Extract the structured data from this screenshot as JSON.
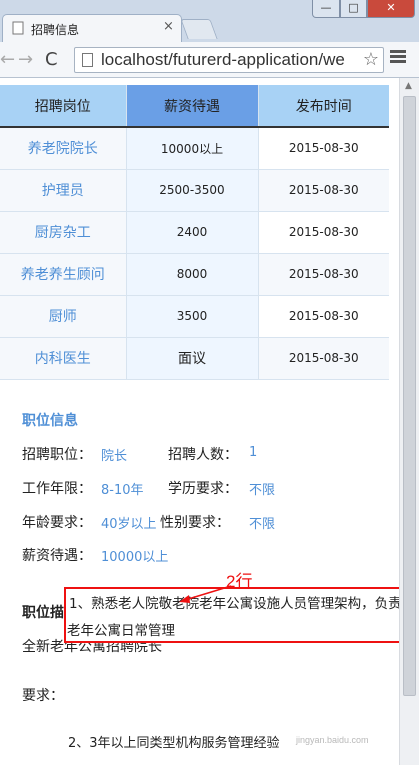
{
  "browser": {
    "tab_title": "招聘信息",
    "tab_close": "×",
    "url": "localhost/futurerd-application/we",
    "window_controls": {
      "minimize": "—",
      "maximize": "□",
      "close": "✕"
    },
    "nav": {
      "back": "←",
      "forward": "→",
      "reload": "C"
    },
    "star": "☆"
  },
  "table": {
    "headers": [
      "招聘岗位",
      "薪资待遇",
      "发布时间"
    ],
    "active_header_index": 1,
    "rows": [
      {
        "position": "养老院院长",
        "salary": "10000以上",
        "date": "2015-08-30"
      },
      {
        "position": "护理员",
        "salary": "2500-3500",
        "date": "2015-08-30"
      },
      {
        "position": "厨房杂工",
        "salary": "2400",
        "date": "2015-08-30"
      },
      {
        "position": "养老养生顾问",
        "salary": "8000",
        "date": "2015-08-30"
      },
      {
        "position": "厨师",
        "salary": "3500",
        "date": "2015-08-30"
      },
      {
        "position": "内科医生",
        "salary": "面议",
        "date": "2015-08-30"
      }
    ]
  },
  "job_info": {
    "title": "职位信息",
    "position_label": "招聘职位：",
    "position_value": "院长",
    "headcount_label": "招聘人数：",
    "headcount_value": "1",
    "experience_label": "工作年限：",
    "experience_value": "8-10年",
    "education_label": "学历要求：",
    "education_value": "不限",
    "age_label": "年龄要求：",
    "age_value": "40岁以上",
    "gender_label": "性别要求：",
    "gender_value": "不限",
    "salary_label": "薪资待遇：",
    "salary_value": "10000以上"
  },
  "job_desc": {
    "title": "职位描述",
    "intro": "全新老年公寓招聘院长",
    "requirements_label": "要求：",
    "req_line1": "1、熟悉老人院敬老院老年公寓设施人员管理架构，负责",
    "req_line2": "老年公寓日常管理",
    "req_line3": "2、3年以上同类型机构服务管理经验"
  },
  "annotation": {
    "text": "2行",
    "color": "#e11111"
  },
  "watermark": "jingyan.baidu.com",
  "colors": {
    "accent_blue": "#4f8fd6",
    "header_blue": "#a8d2f5",
    "header_active": "#6a9fe6"
  }
}
